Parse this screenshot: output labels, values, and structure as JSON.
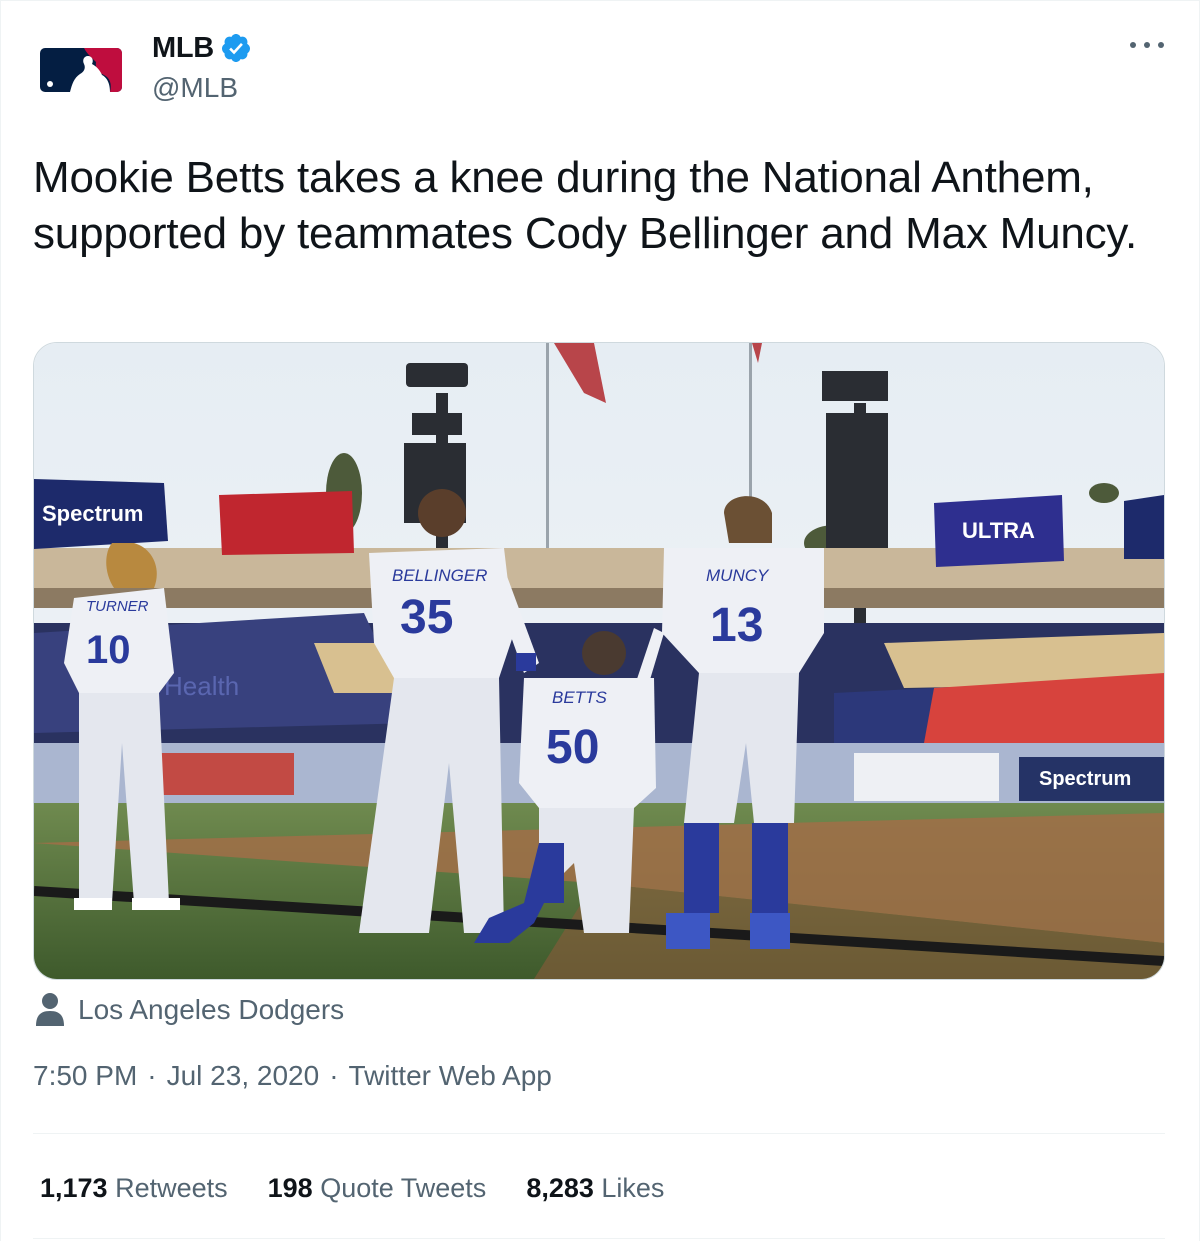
{
  "author": {
    "name": "MLB",
    "handle": "@MLB",
    "verified_icon": "verified-badge-icon",
    "avatar_icon": "mlb-logo-icon"
  },
  "tweet": {
    "text": "Mookie Betts takes a knee during the National Anthem, supported by teammates Cody Bellinger and Max Muncy."
  },
  "photo": {
    "jersey_names": [
      "TURNER",
      "BELLINGER",
      "BETTS",
      "MUNCY"
    ],
    "jersey_numbers": [
      "10",
      "35",
      "50",
      "13"
    ],
    "signs": [
      "Spectrum",
      "ULTRA",
      "Health",
      "Spectrum"
    ]
  },
  "tagged": {
    "icon": "person-icon",
    "label": "Los Angeles Dodgers"
  },
  "meta": {
    "time": "7:50 PM",
    "date": "Jul 23, 2020",
    "source": "Twitter Web App",
    "separator": "·"
  },
  "stats": {
    "retweets_count": "1,173",
    "retweets_label": "Retweets",
    "quotes_count": "198",
    "quotes_label": "Quote Tweets",
    "likes_count": "8,283",
    "likes_label": "Likes"
  },
  "colors": {
    "text_primary": "#0f1419",
    "text_secondary": "#536471",
    "verified_blue": "#1d9bf0",
    "mlb_navy": "#041e42",
    "mlb_red": "#bf0d3e",
    "dodger_blue": "#2a3a9c"
  }
}
